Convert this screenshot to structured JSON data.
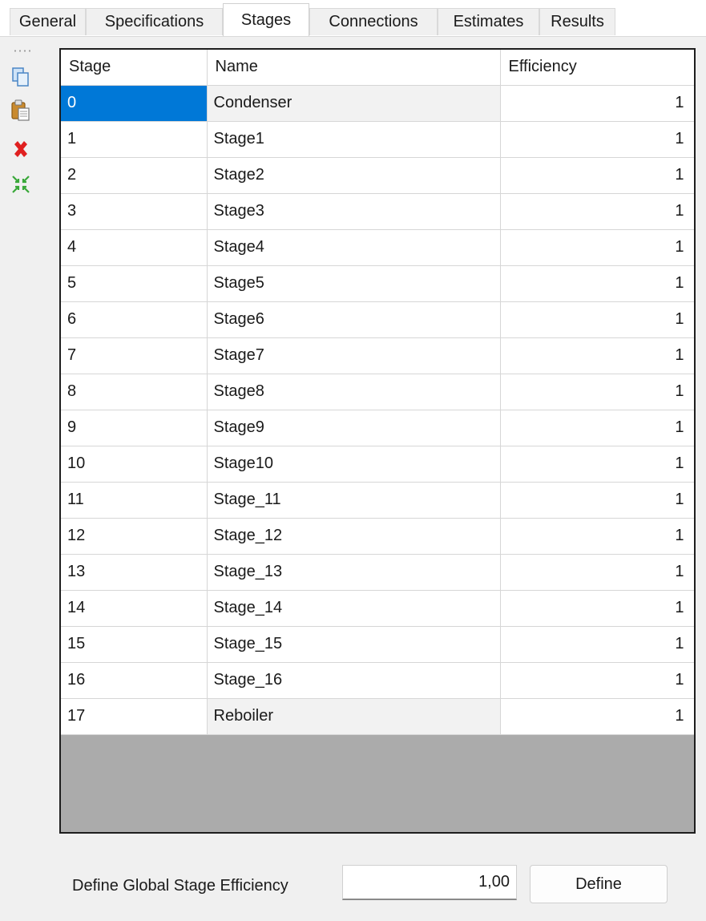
{
  "tabs": [
    {
      "label": "General",
      "active": false
    },
    {
      "label": "Specifications",
      "active": false
    },
    {
      "label": "Stages",
      "active": true
    },
    {
      "label": "Connections",
      "active": false
    },
    {
      "label": "Estimates",
      "active": false
    },
    {
      "label": "Results",
      "active": false
    }
  ],
  "toolbar": {
    "icons": [
      "copy-icon",
      "paste-icon",
      "delete-icon",
      "collapse-icon"
    ]
  },
  "table": {
    "headers": {
      "stage": "Stage",
      "name": "Name",
      "efficiency": "Efficiency"
    },
    "rows": [
      {
        "stage": "0",
        "name": "Condenser",
        "efficiency": "1"
      },
      {
        "stage": "1",
        "name": "Stage1",
        "efficiency": "1"
      },
      {
        "stage": "2",
        "name": "Stage2",
        "efficiency": "1"
      },
      {
        "stage": "3",
        "name": "Stage3",
        "efficiency": "1"
      },
      {
        "stage": "4",
        "name": "Stage4",
        "efficiency": "1"
      },
      {
        "stage": "5",
        "name": "Stage5",
        "efficiency": "1"
      },
      {
        "stage": "6",
        "name": "Stage6",
        "efficiency": "1"
      },
      {
        "stage": "7",
        "name": "Stage7",
        "efficiency": "1"
      },
      {
        "stage": "8",
        "name": "Stage8",
        "efficiency": "1"
      },
      {
        "stage": "9",
        "name": "Stage9",
        "efficiency": "1"
      },
      {
        "stage": "10",
        "name": "Stage10",
        "efficiency": "1"
      },
      {
        "stage": "11",
        "name": "Stage_11",
        "efficiency": "1"
      },
      {
        "stage": "12",
        "name": "Stage_12",
        "efficiency": "1"
      },
      {
        "stage": "13",
        "name": "Stage_13",
        "efficiency": "1"
      },
      {
        "stage": "14",
        "name": "Stage_14",
        "efficiency": "1"
      },
      {
        "stage": "15",
        "name": "Stage_15",
        "efficiency": "1"
      },
      {
        "stage": "16",
        "name": "Stage_16",
        "efficiency": "1"
      },
      {
        "stage": "17",
        "name": "Reboiler",
        "efficiency": "1"
      }
    ]
  },
  "global_efficiency": {
    "label": "Define Global Stage Efficiency",
    "value": "1,00",
    "button_label": "Define"
  },
  "colors": {
    "selection": "#0078d7",
    "empty_grid": "#ababab",
    "delete_icon": "#e02020"
  }
}
